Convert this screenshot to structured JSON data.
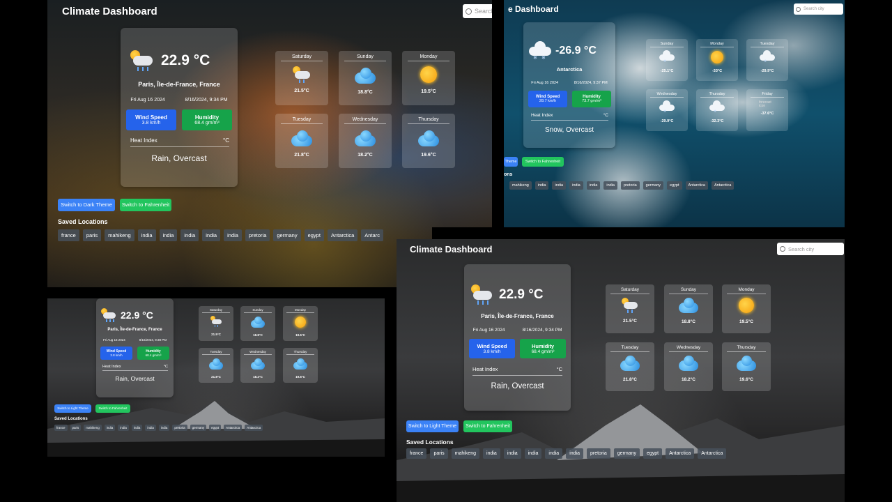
{
  "panel_a": {
    "title": "Climate Dashboard",
    "search_placeholder": "Search",
    "temp": "22.9 °C",
    "location": "Paris, Île-de-France, France",
    "date": "Fri Aug 16 2024",
    "datetime": "8/16/2024, 9:34 PM",
    "wind_label": "Wind Speed",
    "wind_value": "3.8 km/h",
    "humidity_label": "Humidity",
    "humidity_value": "68.4 gm/m³",
    "heat_label": "Heat Index",
    "heat_unit": "°C",
    "condition": "Rain, Overcast",
    "forecast": [
      {
        "day": "Saturday",
        "temp": "21.5°C",
        "icon": "partly-cloudy-rain-icon"
      },
      {
        "day": "Sunday",
        "temp": "18.8°C",
        "icon": "cloud-icon"
      },
      {
        "day": "Monday",
        "temp": "19.5°C",
        "icon": "sun-icon"
      },
      {
        "day": "Tuesday",
        "temp": "21.8°C",
        "icon": "cloud-icon"
      },
      {
        "day": "Wednesday",
        "temp": "18.2°C",
        "icon": "cloud-icon"
      },
      {
        "day": "Thursday",
        "temp": "19.6°C",
        "icon": "cloud-icon"
      }
    ],
    "theme_button": "Switch to Dark Theme",
    "unit_button": "Switch to Fahrenheit",
    "saved_title": "Saved Locations",
    "saved": [
      "france",
      "paris",
      "mahikeng",
      "india",
      "india",
      "india",
      "india",
      "india",
      "pretoria",
      "germany",
      "egypt",
      "Antarctica",
      "Antarc"
    ]
  },
  "panel_b": {
    "title": "e Dashboard",
    "search_placeholder": "Search city",
    "temp": "-26.9 °C",
    "location": "Antarctica",
    "date": "Fri Aug 16 2024",
    "datetime": "8/16/2024, 9:37 PM",
    "wind_label": "Wind Speed",
    "wind_value": "28.7 km/h",
    "humidity_label": "Humidity",
    "humidity_value": "73.7 gm/m³",
    "heat_label": "Heat Index",
    "heat_unit": "°C",
    "condition": "Snow, Overcast",
    "forecast": [
      {
        "day": "Sunday",
        "temp": "-25.1°C",
        "icon": "snow-cloud-icon"
      },
      {
        "day": "Monday",
        "temp": "-33°C",
        "icon": "sun-icon"
      },
      {
        "day": "Tuesday",
        "temp": "-29.9°C",
        "icon": "snow-cloud-icon"
      },
      {
        "day": "Wednesday",
        "temp": "-29.9°C",
        "icon": "snow-cloud-icon"
      },
      {
        "day": "Thursday",
        "temp": "-32.3°C",
        "icon": "snow-cloud-icon"
      },
      {
        "day": "Friday",
        "temp": "-37.6°C",
        "icon": "broken-image-icon",
        "alt": "forecast icon"
      }
    ],
    "theme_button": "Theme",
    "unit_button": "Switch to Fahrenheit",
    "saved_title": "ons",
    "saved": [
      "mahikeng",
      "india",
      "india",
      "india",
      "india",
      "india",
      "pretoria",
      "germany",
      "egypt",
      "Antarctica",
      "Antarctica"
    ]
  },
  "panel_c": {
    "temp": "22.9 °C",
    "location": "Paris, Île-de-France, France",
    "date": "Fri Aug 16 2024",
    "datetime": "8/16/2024, 9:38 PM",
    "wind_label": "Wind Speed",
    "wind_value": "3.8 km/h",
    "humidity_label": "Humidity",
    "humidity_value": "68.4 gm/m³",
    "heat_label": "Heat Index",
    "heat_unit": "°C",
    "condition": "Rain, Overcast",
    "forecast": [
      {
        "day": "Saturday",
        "temp": "21.5°C",
        "icon": "partly-cloudy-rain-icon"
      },
      {
        "day": "Sunday",
        "temp": "18.8°C",
        "icon": "cloud-icon"
      },
      {
        "day": "Monday",
        "temp": "19.5°C",
        "icon": "sun-icon"
      },
      {
        "day": "Tuesday",
        "temp": "21.8°C",
        "icon": "cloud-icon"
      },
      {
        "day": "Wednesday",
        "temp": "18.2°C",
        "icon": "cloud-icon"
      },
      {
        "day": "Thursday",
        "temp": "19.6°C",
        "icon": "cloud-icon"
      }
    ],
    "theme_button": "Switch to Light Theme",
    "unit_button": "Switch to Fahrenheit",
    "saved_title": "Saved Locations",
    "saved": [
      "france",
      "paris",
      "mahikeng",
      "india",
      "india",
      "india",
      "india",
      "india",
      "pretoria",
      "germany",
      "egypt",
      "Antarctica",
      "Antarctica"
    ]
  },
  "panel_d": {
    "title": "Climate Dashboard",
    "search_placeholder": "Search city",
    "temp": "22.9 °C",
    "location": "Paris, Île-de-France, France",
    "date": "Fri Aug 16 2024",
    "datetime": "8/16/2024, 9:34 PM",
    "wind_label": "Wind Speed",
    "wind_value": "3.8 km/h",
    "humidity_label": "Humidity",
    "humidity_value": "68.4 gm/m³",
    "heat_label": "Heat Index",
    "heat_unit": "°C",
    "condition": "Rain, Overcast",
    "forecast": [
      {
        "day": "Saturday",
        "temp": "21.5°C",
        "icon": "partly-cloudy-rain-icon"
      },
      {
        "day": "Sunday",
        "temp": "18.8°C",
        "icon": "cloud-icon"
      },
      {
        "day": "Monday",
        "temp": "19.5°C",
        "icon": "sun-icon"
      },
      {
        "day": "Tuesday",
        "temp": "21.8°C",
        "icon": "cloud-icon"
      },
      {
        "day": "Wednesday",
        "temp": "18.2°C",
        "icon": "cloud-icon"
      },
      {
        "day": "Thursday",
        "temp": "19.6°C",
        "icon": "cloud-icon"
      }
    ],
    "theme_button": "Switch to Light Theme",
    "unit_button": "Switch to Fahrenheit",
    "saved_title": "Saved Locations",
    "saved": [
      "france",
      "paris",
      "mahikeng",
      "india",
      "india",
      "india",
      "india",
      "india",
      "pretoria",
      "germany",
      "egypt",
      "Antarctica",
      "Antarctica"
    ]
  },
  "colors": {
    "wind": "#2563eb",
    "humidity": "#16a34a",
    "btn_blue": "#3b82f6",
    "btn_green": "#22c55e"
  }
}
